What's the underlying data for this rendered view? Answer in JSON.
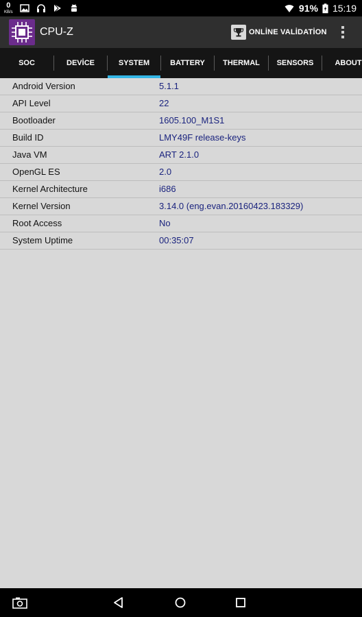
{
  "statusbar": {
    "speed_value": "0",
    "speed_unit": "KB/s",
    "icons_left": [
      "gallery-icon",
      "headphones-icon",
      "play-store-icon",
      "android-icon"
    ],
    "icons_right": [
      "wifi-icon",
      "battery-icon"
    ],
    "battery": "91%",
    "time": "15:19"
  },
  "appbar": {
    "title": "CPU-Z",
    "online_validation": "ONLİNE VALİDATİON",
    "accent": "#6b2c8c"
  },
  "tabs": [
    {
      "label": "SOC"
    },
    {
      "label": "DEVİCE"
    },
    {
      "label": "SYSTEM",
      "selected": true
    },
    {
      "label": "BATTERY"
    },
    {
      "label": "THERMAL"
    },
    {
      "label": "SENSORS"
    },
    {
      "label": "ABOUT"
    }
  ],
  "system_info": [
    {
      "key": "Android Version",
      "value": "5.1.1"
    },
    {
      "key": "API Level",
      "value": "22"
    },
    {
      "key": "Bootloader",
      "value": "1605.100_M1S1"
    },
    {
      "key": "Build ID",
      "value": "LMY49F release-keys"
    },
    {
      "key": "Java VM",
      "value": "ART 2.1.0"
    },
    {
      "key": "OpenGL ES",
      "value": "2.0"
    },
    {
      "key": "Kernel Architecture",
      "value": "i686"
    },
    {
      "key": "Kernel Version",
      "value": "3.14.0 (eng.evan.20160423.183329)"
    },
    {
      "key": "Root Access",
      "value": "No"
    },
    {
      "key": "System Uptime",
      "value": "00:35:07"
    }
  ],
  "navbar": {
    "buttons": [
      "screenshot-icon",
      "back-icon",
      "home-icon",
      "recents-icon"
    ]
  },
  "colors": {
    "tab_indicator": "#33b5e5",
    "value_text": "#1a237e"
  }
}
